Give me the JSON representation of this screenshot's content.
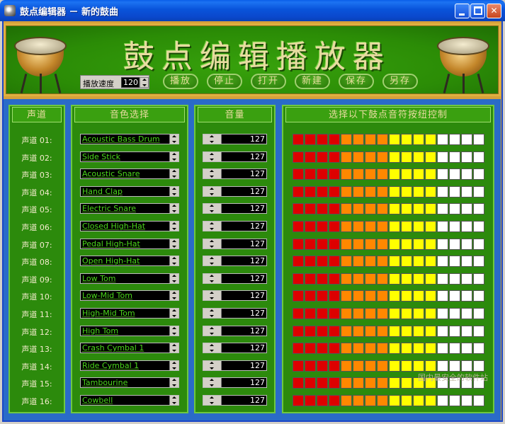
{
  "window": {
    "title": "鼓点编辑器 － 新的鼓曲",
    "minimize_label": "",
    "maximize_label": "",
    "close_label": "✕"
  },
  "header": {
    "title": "鼓点编辑播放器",
    "speed_label": "播放速度",
    "speed_value": "120",
    "buttons": [
      "播放",
      "停止",
      "打开",
      "新建",
      "保存",
      "另存"
    ]
  },
  "columns": {
    "channel": "声道",
    "instrument": "音色选择",
    "volume": "音量",
    "beats": "选择以下鼓点音符按纽控制"
  },
  "rows": [
    {
      "label": "声道 01:",
      "instrument": "Acoustic Bass Drum",
      "volume": "127"
    },
    {
      "label": "声道 02:",
      "instrument": "Side Stick",
      "volume": "127"
    },
    {
      "label": "声道 03:",
      "instrument": "Acoustic Snare",
      "volume": "127"
    },
    {
      "label": "声道 04:",
      "instrument": "Hand Clap",
      "volume": "127"
    },
    {
      "label": "声道 05:",
      "instrument": "Electric Snare",
      "volume": "127"
    },
    {
      "label": "声道 06:",
      "instrument": "Closed High-Hat",
      "volume": "127"
    },
    {
      "label": "声道 07:",
      "instrument": "Pedal High-Hat",
      "volume": "127"
    },
    {
      "label": "声道 08:",
      "instrument": "Open High-Hat",
      "volume": "127"
    },
    {
      "label": "声道 09:",
      "instrument": "Low Tom",
      "volume": "127"
    },
    {
      "label": "声道 10:",
      "instrument": "Low-Mid Tom",
      "volume": "127"
    },
    {
      "label": "声道 11:",
      "instrument": "High-Mid Tom",
      "volume": "127"
    },
    {
      "label": "声道 12:",
      "instrument": "High Tom",
      "volume": "127"
    },
    {
      "label": "声道 13:",
      "instrument": "Crash Cymbal 1",
      "volume": "127"
    },
    {
      "label": "声道 14:",
      "instrument": "Ride Cymbal 1",
      "volume": "127"
    },
    {
      "label": "声道 15:",
      "instrument": "Tambourine",
      "volume": "127"
    },
    {
      "label": "声道 16:",
      "instrument": "Cowbell",
      "volume": "127"
    }
  ],
  "beat_colors": [
    "red",
    "red",
    "red",
    "red",
    "orange",
    "orange",
    "orange",
    "orange",
    "yellow",
    "yellow",
    "yellow",
    "yellow",
    "white",
    "white",
    "white",
    "white"
  ],
  "watermark": "国内最安全的软件站"
}
